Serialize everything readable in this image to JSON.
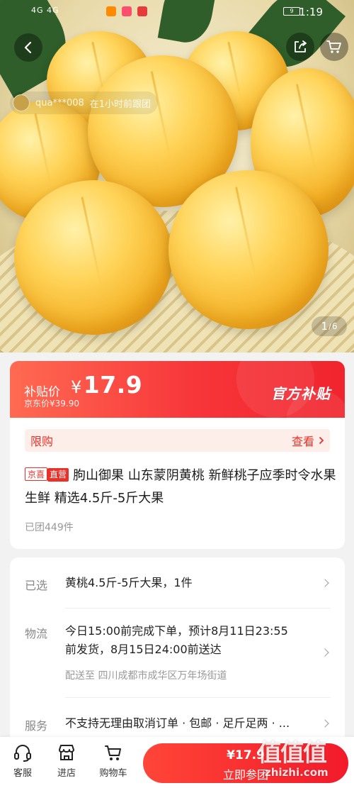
{
  "status_bar": {
    "signal_text": "4G 4G",
    "time": "1:19",
    "battery": "9"
  },
  "hero": {
    "follow": {
      "user": "qua***008",
      "action": "在1小时前跟团"
    },
    "pager": {
      "current": "1",
      "separator": "/",
      "total": "6"
    }
  },
  "price": {
    "subsidy_label": "补贴价",
    "currency": "¥",
    "subsidy_price": "17.9",
    "jd_price": "京东价¥39.90",
    "official_badge": "官方补贴",
    "accent": "#f0242d"
  },
  "limit": {
    "label": "限购",
    "more": "查看"
  },
  "product": {
    "tag_jingxi": "京喜",
    "tag_ziying": "直营",
    "title": "朐山御果 山东蒙阴黄桃 新鲜桃子应季时令水果生鲜 精选4.5斤-5斤大果",
    "grouped": "已团449件"
  },
  "info": {
    "selected_label": "已选",
    "selected_value": "黄桃4.5斤-5斤大果，1件",
    "logistics_label": "物流",
    "logistics_line1": "今日15:00前完成下单，预计8月11日23:55",
    "logistics_line2": "前发货，8月15日24:00前送达",
    "delivery_to": "配送至  四川成都市成华区万年场街道",
    "service_label": "服务",
    "service_value": "不支持无理由取消订单 · 包邮 · 足斤足两 · ..."
  },
  "bottom_bar": {
    "service": "客服",
    "store": "进店",
    "cart": "购物车",
    "buy_price": "¥17.9",
    "buy_label": "立即参团"
  },
  "watermark": {
    "logo": "值值值",
    "url": "zhizhi.com"
  },
  "icons": [
    "back-icon",
    "share-icon",
    "cart-icon",
    "headset-icon",
    "store-icon",
    "chevron-right-icon"
  ]
}
